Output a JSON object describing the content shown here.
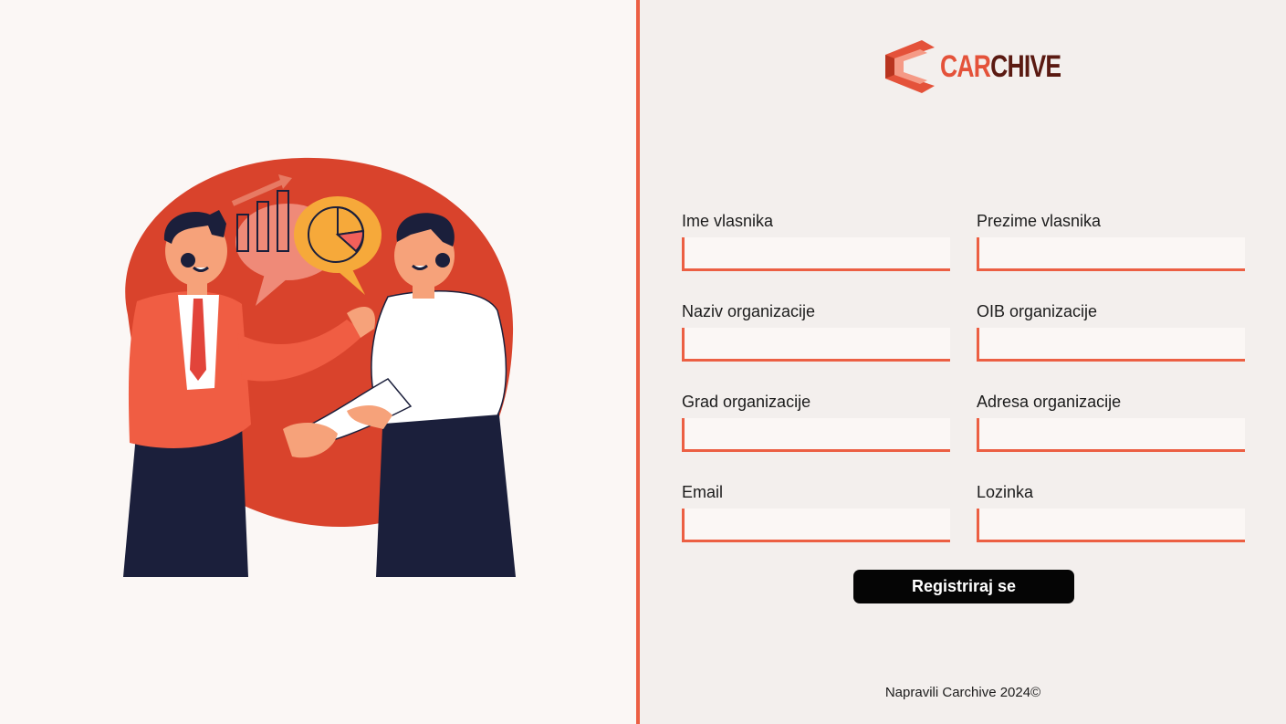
{
  "brand": {
    "name_part1": "CAR",
    "name_part2": "CHIVE",
    "color_primary": "#e4523a",
    "color_dark": "#5a1a12"
  },
  "illustration": {
    "subject": "two-business-people-handshake",
    "blob_color": "#d9432c"
  },
  "form": {
    "fields": [
      {
        "label": "Ime vlasnika",
        "value": "",
        "placeholder": ""
      },
      {
        "label": "Prezime vlasnika",
        "value": "",
        "placeholder": ""
      },
      {
        "label": "Naziv organizacije",
        "value": "",
        "placeholder": ""
      },
      {
        "label": "OIB organizacije",
        "value": "",
        "placeholder": ""
      },
      {
        "label": "Grad organizacije",
        "value": "",
        "placeholder": ""
      },
      {
        "label": "Adresa organizacije",
        "value": "",
        "placeholder": ""
      },
      {
        "label": "Email",
        "value": "",
        "placeholder": ""
      },
      {
        "label": "Lozinka",
        "value": "",
        "placeholder": ""
      }
    ],
    "submit_label": "Registriraj se"
  },
  "footer": {
    "text": "Napravili Carchive 2024©"
  },
  "colors": {
    "accent": "#ec5f43",
    "left_bg": "#fbf7f5",
    "right_bg": "#f3efed",
    "button_bg": "#050505"
  }
}
